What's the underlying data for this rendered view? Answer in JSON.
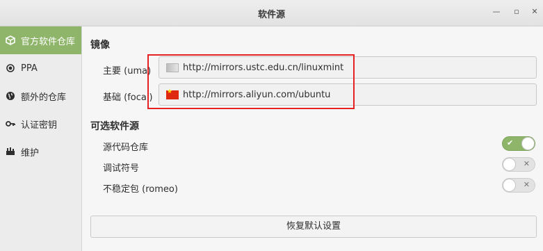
{
  "window": {
    "title": "软件源"
  },
  "sidebar": {
    "items": [
      {
        "label": "官方软件仓库",
        "icon": "package-icon",
        "active": true
      },
      {
        "label": "PPA",
        "icon": "radio-icon",
        "active": false
      },
      {
        "label": "额外的仓库",
        "icon": "globe-icon",
        "active": false
      },
      {
        "label": "认证密钥",
        "icon": "key-icon",
        "active": false
      },
      {
        "label": "维护",
        "icon": "tools-icon",
        "active": false
      }
    ]
  },
  "mirrors": {
    "section_title": "镜像",
    "main": {
      "label": "主要 (uma)",
      "url": "http://mirrors.ustc.edu.cn/linuxmint"
    },
    "base": {
      "label": "基础 (focal)",
      "url": "http://mirrors.aliyun.com/ubuntu"
    }
  },
  "optional": {
    "section_title": "可选软件源",
    "items": [
      {
        "label": "源代码仓库",
        "enabled": true
      },
      {
        "label": "调试符号",
        "enabled": false
      },
      {
        "label": "不稳定包 (romeo)",
        "enabled": false
      }
    ]
  },
  "reset_label": "恢复默认设置",
  "colors": {
    "accent": "#8fb56b",
    "highlight": "#e52121"
  }
}
